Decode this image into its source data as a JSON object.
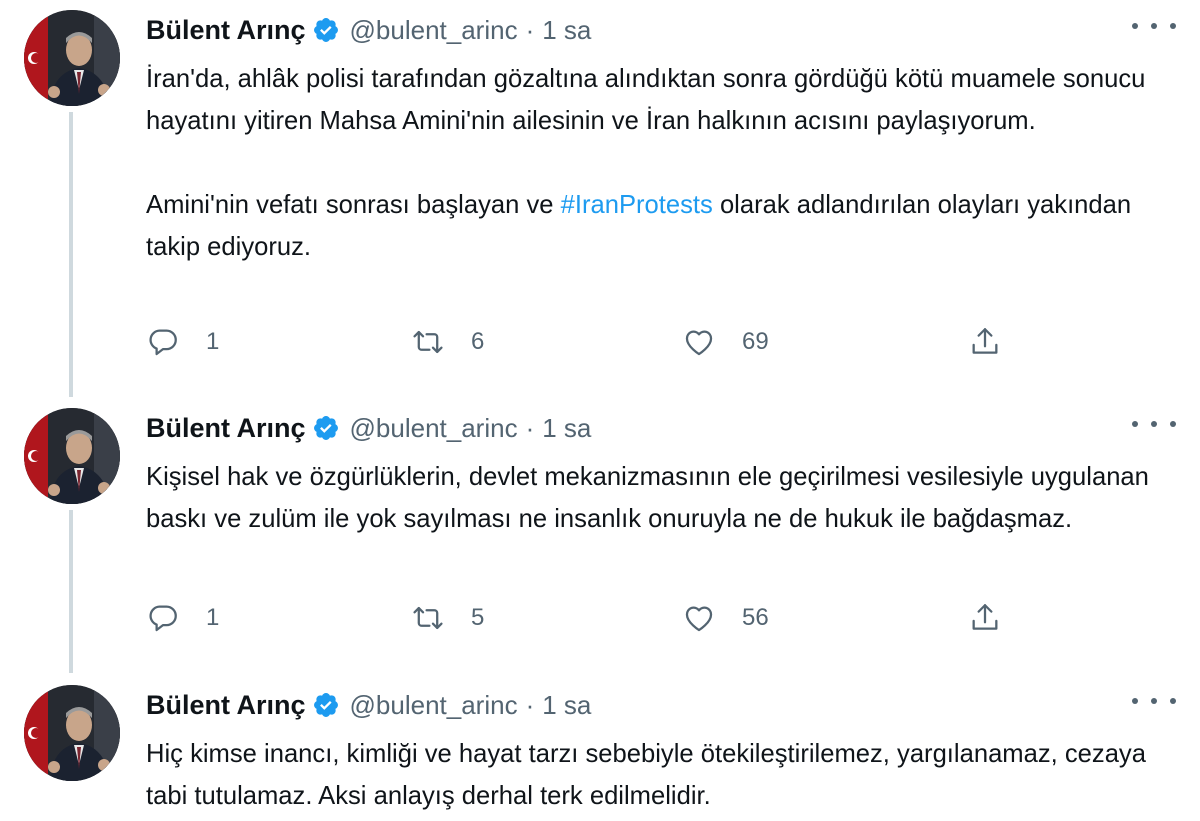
{
  "colors": {
    "accent": "#1d9bf0",
    "text": "#0f1419",
    "secondary": "#536471",
    "thread_line": "#cfd9de"
  },
  "tweets": [
    {
      "name": "Bülent Arınç",
      "handle": "@bulent_arinc",
      "separator": "·",
      "time": "1 sa",
      "paragraphs": [
        "İran'da, ahlâk polisi tarafından gözaltına alındıktan sonra gördüğü kötü muamele sonucu hayatını yitiren Mahsa Amini'nin ailesinin ve İran halkının acısını paylaşıyorum."
      ],
      "p2_before": "Amini'nin vefatı sonrası başlayan ve ",
      "hashtag": "#IranProtests",
      "p2_after": " olarak adlandırılan olayları yakından takip ediyoruz.",
      "replies": "1",
      "retweets": "6",
      "likes": "69"
    },
    {
      "name": "Bülent Arınç",
      "handle": "@bulent_arinc",
      "separator": "·",
      "time": "1 sa",
      "text": "Kişisel hak ve özgürlüklerin, devlet mekanizmasının ele geçirilmesi vesilesiyle uygulanan baskı ve zulüm ile yok sayılması ne insanlık onuruyla ne de hukuk ile bağdaşmaz.",
      "replies": "1",
      "retweets": "5",
      "likes": "56"
    },
    {
      "name": "Bülent Arınç",
      "handle": "@bulent_arinc",
      "separator": "·",
      "time": "1 sa",
      "text": "Hiç kimse inancı, kimliği ve hayat tarzı sebebiyle ötekileştirilemez, yargılanamaz, cezaya tabi tutulamaz. Aksi anlayış derhal terk edilmelidir."
    }
  ]
}
